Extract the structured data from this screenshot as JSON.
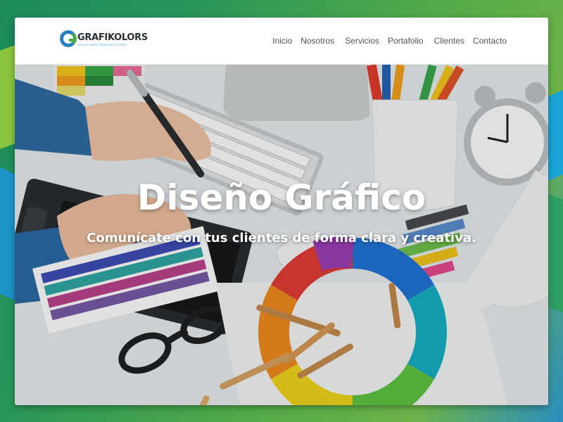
{
  "brand": {
    "name": "GRAFIKOLORS",
    "tagline": "SOLUCIONES GRÁFICAS & WEB"
  },
  "nav": {
    "items": [
      "Inicio",
      "Nosotros",
      "Servicios",
      "Portafolio",
      "Clientes",
      "Contacto"
    ]
  },
  "hero": {
    "title": "Diseño Gráfico",
    "subtitle": "Comunícate con tus clientes de forma clara y creativa."
  },
  "colors": {
    "brand_blue": "#2a7fbf",
    "brand_green": "#49a94a",
    "nav_text": "#555555",
    "hero_text": "#ffffff"
  },
  "icons": [
    "logo-g-icon"
  ]
}
